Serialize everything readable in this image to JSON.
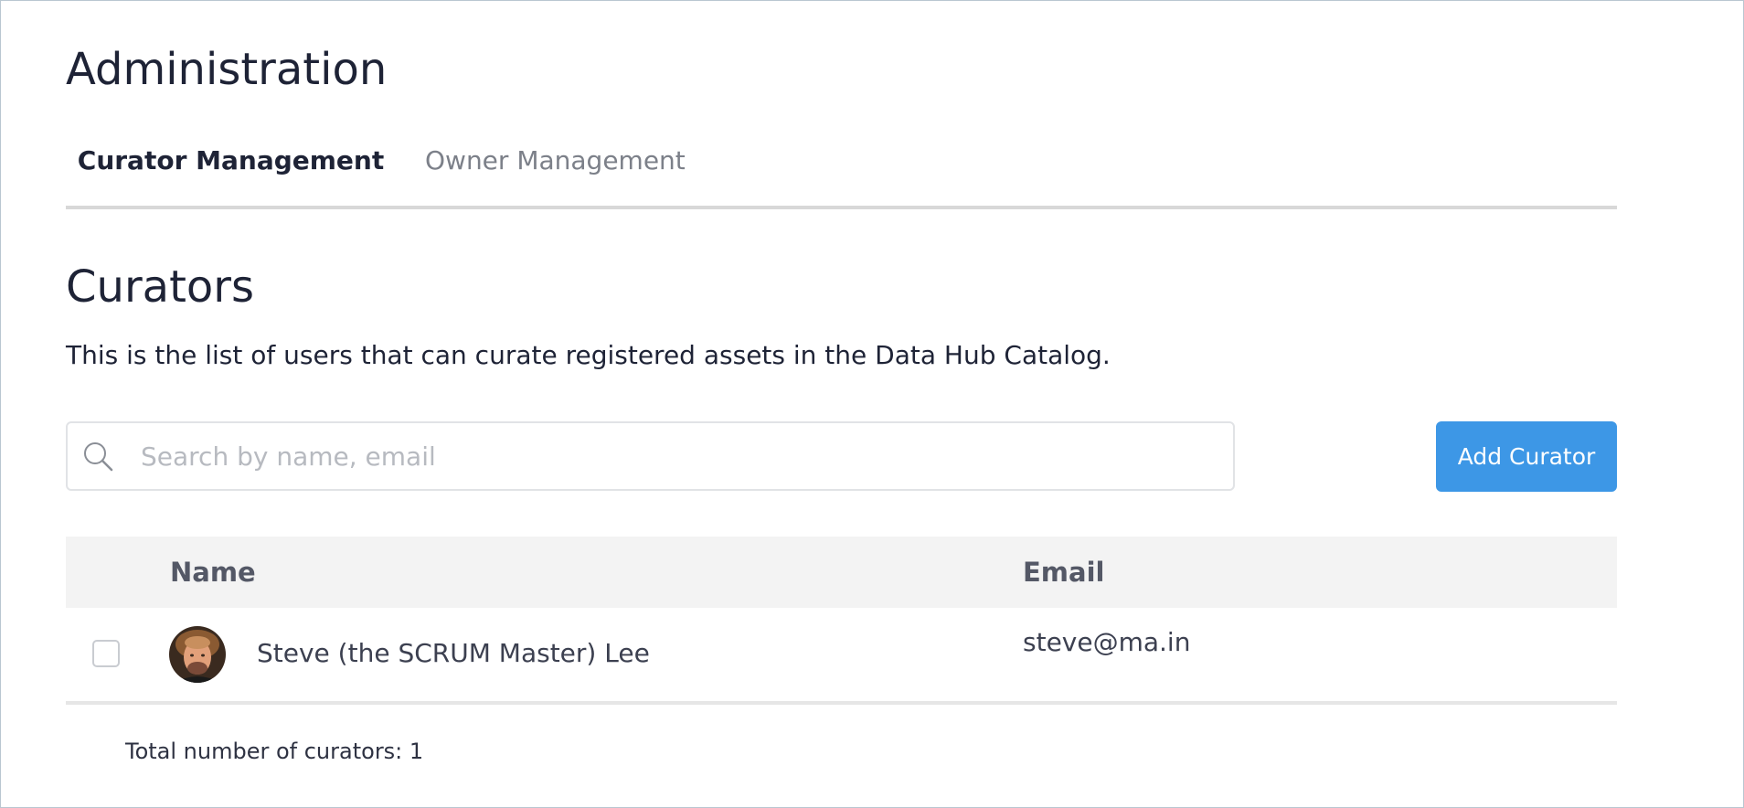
{
  "page": {
    "title": "Administration"
  },
  "tabs": [
    {
      "label": "Curator Management",
      "active": true
    },
    {
      "label": "Owner Management",
      "active": false
    }
  ],
  "section": {
    "title": "Curators",
    "description": "This is the list of users that can curate registered assets in the Data Hub Catalog."
  },
  "search": {
    "placeholder": "Search by name, email",
    "value": "",
    "icon": "search-icon"
  },
  "actions": {
    "add_label": "Add Curator"
  },
  "table": {
    "columns": [
      "Name",
      "Email"
    ],
    "rows": [
      {
        "name": "Steve (the SCRUM Master) Lee",
        "email": "steve@ma.in",
        "selected": false
      }
    ]
  },
  "footer": {
    "total": "Total number of curators: 1"
  },
  "colors": {
    "primary_button": "#3d97e6",
    "heading": "#1e2336",
    "tab_inactive": "#7c8089",
    "table_header_bg": "#f3f3f3"
  }
}
